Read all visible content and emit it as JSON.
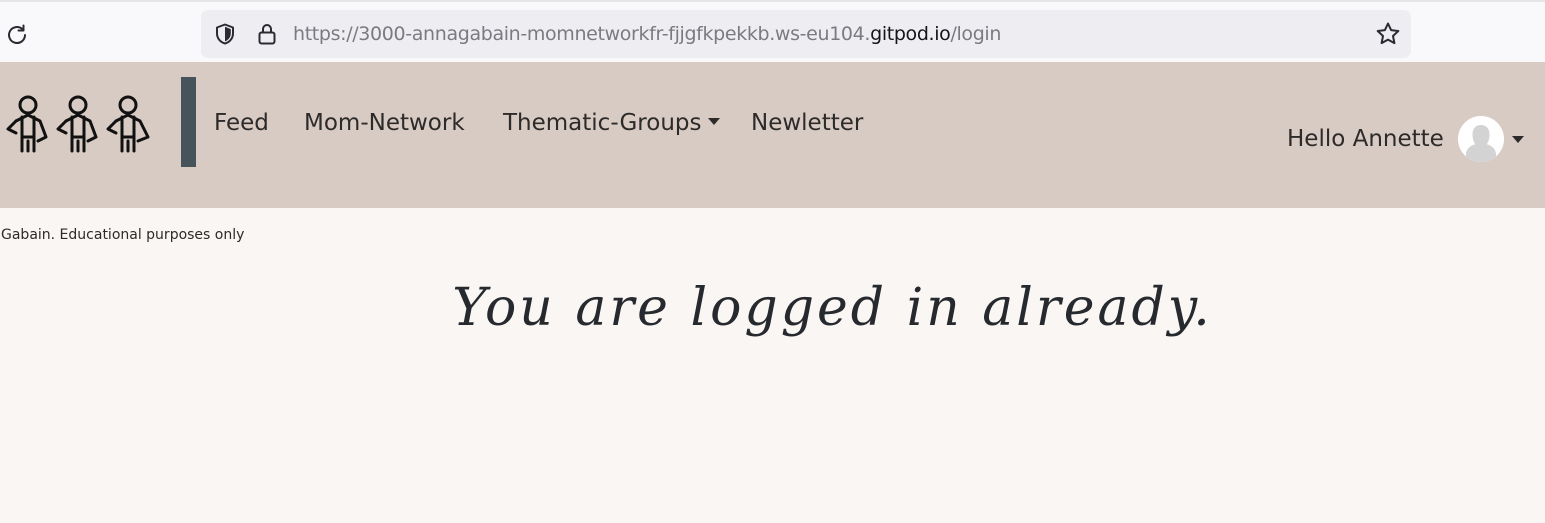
{
  "browser": {
    "url_prefix": "https://3000-annagabain-momnetworkfr-fjjgfkpekkb.ws-eu104.",
    "url_domain": "gitpod.io",
    "url_path": "/login"
  },
  "navbar": {
    "links": {
      "feed": "Feed",
      "mom_network": "Mom-Network",
      "thematic_groups": "Thematic-Groups",
      "newsletter": "Newletter"
    },
    "greeting": "Hello Annette"
  },
  "content": {
    "footer_note": "Gabain. Educational purposes only",
    "message": "You are logged in already."
  },
  "colors": {
    "navbar_bg": "#d8cbc3",
    "page_bg": "#faf6f3",
    "divider": "#46535a"
  },
  "icons": [
    "reload-icon",
    "shield-icon",
    "lock-icon",
    "star-icon",
    "logo-icon",
    "caret-down-icon",
    "avatar"
  ]
}
